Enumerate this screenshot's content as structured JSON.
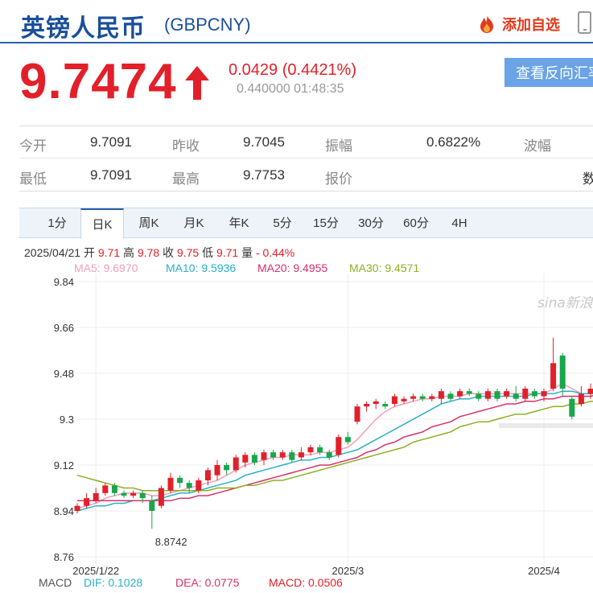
{
  "header": {
    "title": "英镑人民币",
    "code": "(GBPCNY)",
    "favorite_label": "添加自选"
  },
  "quote": {
    "price": "9.7474",
    "change": "0.0429 (0.4421%)",
    "sub": "0.440000 01:48:35",
    "reverse_label": "查看反向汇率"
  },
  "stats": [
    [
      {
        "label": "今开",
        "value": "9.7091"
      },
      {
        "label": "昨收",
        "value": "9.7045"
      },
      {
        "label": "振幅",
        "value": "0.6822%"
      },
      {
        "label": "波幅",
        "value": ""
      }
    ],
    [
      {
        "label": "最低",
        "value": "9.7091"
      },
      {
        "label": "最高",
        "value": "9.7753"
      },
      {
        "label": "报价",
        "value": "数"
      }
    ]
  ],
  "tabs": [
    "1分",
    "日K",
    "周K",
    "月K",
    "年K",
    "5分",
    "15分",
    "30分",
    "60分",
    "4H"
  ],
  "active_tab": "日K",
  "candle_info": {
    "date": "2025/04/21",
    "open_label": "开",
    "open": "9.71",
    "high_label": "高",
    "high": "9.78",
    "close_label": "收",
    "close": "9.75",
    "low_label": "低",
    "low": "9.71",
    "vol_label": "量",
    "vol": "-",
    "pct": "0.44%"
  },
  "ma_legend": [
    {
      "label": "MA5: 9.6970",
      "color": "#f0a0b8"
    },
    {
      "label": "MA10: 9.5936",
      "color": "#2ab0c8"
    },
    {
      "label": "MA20: 9.4955",
      "color": "#d8306a"
    },
    {
      "label": "MA30: 9.4571",
      "color": "#8cb020"
    }
  ],
  "macd": {
    "label": "MACD",
    "dif": "DIF: 0.1028",
    "dea": "DEA: 0.0775",
    "macd": "MACD: 0.0506"
  },
  "colors": {
    "up": "#e2202a",
    "down": "#1aa64a",
    "accent": "#1a4f9c"
  },
  "watermark": "sina新浪",
  "chart_data": {
    "type": "candlestick",
    "y_ticks": [
      "9.84",
      "9.66",
      "9.48",
      "9.3",
      "9.12",
      "8.94",
      "8.76"
    ],
    "ylim": [
      8.76,
      9.84
    ],
    "x_ticks": [
      {
        "label": "2025/1/22",
        "index": 2
      },
      {
        "label": "2025/3",
        "index": 29
      },
      {
        "label": "2025/4",
        "index": 50
      }
    ],
    "min_label": {
      "text": "8.8742",
      "index": 8,
      "value": 8.8742
    },
    "candles": [
      {
        "o": 8.94,
        "c": 8.96,
        "h": 8.97,
        "l": 8.93
      },
      {
        "o": 8.96,
        "c": 8.99,
        "h": 9.01,
        "l": 8.95
      },
      {
        "o": 8.98,
        "c": 9.01,
        "h": 9.03,
        "l": 8.97
      },
      {
        "o": 9.01,
        "c": 9.04,
        "h": 9.05,
        "l": 9.0
      },
      {
        "o": 9.04,
        "c": 9.01,
        "h": 9.05,
        "l": 9.0
      },
      {
        "o": 9.01,
        "c": 9.0,
        "h": 9.02,
        "l": 8.99
      },
      {
        "o": 9.0,
        "c": 9.01,
        "h": 9.02,
        "l": 8.99
      },
      {
        "o": 9.01,
        "c": 8.99,
        "h": 9.02,
        "l": 8.97
      },
      {
        "o": 8.98,
        "c": 8.94,
        "h": 9.0,
        "l": 8.87
      },
      {
        "o": 8.96,
        "c": 9.03,
        "h": 9.04,
        "l": 8.95
      },
      {
        "o": 9.02,
        "c": 9.07,
        "h": 9.09,
        "l": 9.01
      },
      {
        "o": 9.07,
        "c": 9.05,
        "h": 9.08,
        "l": 9.03
      },
      {
        "o": 9.05,
        "c": 9.03,
        "h": 9.06,
        "l": 9.01
      },
      {
        "o": 9.02,
        "c": 9.06,
        "h": 9.07,
        "l": 9.01
      },
      {
        "o": 9.06,
        "c": 9.1,
        "h": 9.11,
        "l": 9.04
      },
      {
        "o": 9.08,
        "c": 9.12,
        "h": 9.14,
        "l": 9.06
      },
      {
        "o": 9.12,
        "c": 9.1,
        "h": 9.13,
        "l": 9.08
      },
      {
        "o": 9.1,
        "c": 9.15,
        "h": 9.16,
        "l": 9.09
      },
      {
        "o": 9.13,
        "c": 9.16,
        "h": 9.17,
        "l": 9.11
      },
      {
        "o": 9.16,
        "c": 9.13,
        "h": 9.17,
        "l": 9.12
      },
      {
        "o": 9.14,
        "c": 9.17,
        "h": 9.18,
        "l": 9.12
      },
      {
        "o": 9.17,
        "c": 9.15,
        "h": 9.18,
        "l": 9.14
      },
      {
        "o": 9.15,
        "c": 9.17,
        "h": 9.18,
        "l": 9.14
      },
      {
        "o": 9.17,
        "c": 9.14,
        "h": 9.18,
        "l": 9.13
      },
      {
        "o": 9.15,
        "c": 9.17,
        "h": 9.19,
        "l": 9.14
      },
      {
        "o": 9.17,
        "c": 9.19,
        "h": 9.2,
        "l": 9.16
      },
      {
        "o": 9.19,
        "c": 9.17,
        "h": 9.2,
        "l": 9.16
      },
      {
        "o": 9.17,
        "c": 9.15,
        "h": 9.18,
        "l": 9.14
      },
      {
        "o": 9.16,
        "c": 9.23,
        "h": 9.24,
        "l": 9.15
      },
      {
        "o": 9.23,
        "c": 9.21,
        "h": 9.25,
        "l": 9.2
      },
      {
        "o": 9.29,
        "c": 9.35,
        "h": 9.36,
        "l": 9.28
      },
      {
        "o": 9.35,
        "c": 9.36,
        "h": 9.37,
        "l": 9.33
      },
      {
        "o": 9.36,
        "c": 9.37,
        "h": 9.38,
        "l": 9.34
      },
      {
        "o": 9.36,
        "c": 9.35,
        "h": 9.37,
        "l": 9.34
      },
      {
        "o": 9.36,
        "c": 9.39,
        "h": 9.4,
        "l": 9.35
      },
      {
        "o": 9.37,
        "c": 9.38,
        "h": 9.39,
        "l": 9.36
      },
      {
        "o": 9.38,
        "c": 9.39,
        "h": 9.4,
        "l": 9.37
      },
      {
        "o": 9.39,
        "c": 9.38,
        "h": 9.4,
        "l": 9.37
      },
      {
        "o": 9.38,
        "c": 9.39,
        "h": 9.4,
        "l": 9.37
      },
      {
        "o": 9.38,
        "c": 9.41,
        "h": 9.42,
        "l": 9.36
      },
      {
        "o": 9.4,
        "c": 9.38,
        "h": 9.41,
        "l": 9.37
      },
      {
        "o": 9.39,
        "c": 9.41,
        "h": 9.42,
        "l": 9.38
      },
      {
        "o": 9.41,
        "c": 9.4,
        "h": 9.42,
        "l": 9.39
      },
      {
        "o": 9.4,
        "c": 9.38,
        "h": 9.41,
        "l": 9.37
      },
      {
        "o": 9.38,
        "c": 9.41,
        "h": 9.42,
        "l": 9.37
      },
      {
        "o": 9.41,
        "c": 9.38,
        "h": 9.42,
        "l": 9.37
      },
      {
        "o": 9.39,
        "c": 9.41,
        "h": 9.42,
        "l": 9.38
      },
      {
        "o": 9.4,
        "c": 9.38,
        "h": 9.43,
        "l": 9.37
      },
      {
        "o": 9.38,
        "c": 9.42,
        "h": 9.43,
        "l": 9.37
      },
      {
        "o": 9.41,
        "c": 9.39,
        "h": 9.42,
        "l": 9.38
      },
      {
        "o": 9.39,
        "c": 9.41,
        "h": 9.42,
        "l": 9.37
      },
      {
        "o": 9.42,
        "c": 9.52,
        "h": 9.62,
        "l": 9.41
      },
      {
        "o": 9.55,
        "c": 9.42,
        "h": 9.56,
        "l": 9.39
      },
      {
        "o": 9.38,
        "c": 9.31,
        "h": 9.39,
        "l": 9.3
      },
      {
        "o": 9.36,
        "c": 9.4,
        "h": 9.43,
        "l": 9.35
      },
      {
        "o": 9.4,
        "c": 9.42,
        "h": 9.44,
        "l": 9.38
      },
      {
        "o": 9.41,
        "c": 9.45,
        "h": 9.47,
        "l": 9.39
      }
    ],
    "series": [
      {
        "name": "MA5",
        "color": "#f0a0b8",
        "values": [
          8.95,
          8.96,
          8.97,
          8.99,
          9.0,
          9.01,
          9.01,
          9.01,
          9.0,
          9.0,
          9.01,
          9.02,
          9.03,
          9.04,
          9.05,
          9.06,
          9.08,
          9.1,
          9.12,
          9.13,
          9.14,
          9.15,
          9.15,
          9.16,
          9.16,
          9.16,
          9.17,
          9.17,
          9.18,
          9.19,
          9.22,
          9.26,
          9.3,
          9.33,
          9.35,
          9.36,
          9.37,
          9.38,
          9.38,
          9.39,
          9.39,
          9.39,
          9.4,
          9.4,
          9.4,
          9.4,
          9.4,
          9.4,
          9.4,
          9.4,
          9.4,
          9.42,
          9.44,
          9.42,
          9.4,
          9.4,
          9.41
        ]
      },
      {
        "name": "MA10",
        "color": "#2ab0c8",
        "values": [
          8.94,
          8.95,
          8.96,
          8.96,
          8.97,
          8.97,
          8.98,
          8.98,
          8.98,
          8.99,
          9.0,
          9.01,
          9.01,
          9.02,
          9.03,
          9.04,
          9.05,
          9.06,
          9.08,
          9.09,
          9.1,
          9.11,
          9.12,
          9.13,
          9.14,
          9.14,
          9.15,
          9.15,
          9.16,
          9.17,
          9.18,
          9.2,
          9.22,
          9.24,
          9.26,
          9.28,
          9.3,
          9.32,
          9.34,
          9.36,
          9.37,
          9.38,
          9.38,
          9.39,
          9.39,
          9.39,
          9.39,
          9.39,
          9.39,
          9.4,
          9.4,
          9.4,
          9.41,
          9.41,
          9.4,
          9.4,
          9.4
        ]
      },
      {
        "name": "MA20",
        "color": "#d8306a",
        "values": [
          8.98,
          8.98,
          8.98,
          8.98,
          8.98,
          8.98,
          8.98,
          8.98,
          8.98,
          8.98,
          8.98,
          8.99,
          8.99,
          9.0,
          9.0,
          9.01,
          9.02,
          9.03,
          9.04,
          9.05,
          9.06,
          9.07,
          9.08,
          9.09,
          9.1,
          9.11,
          9.12,
          9.12,
          9.13,
          9.14,
          9.15,
          9.17,
          9.18,
          9.2,
          9.21,
          9.23,
          9.24,
          9.25,
          9.27,
          9.28,
          9.29,
          9.31,
          9.32,
          9.33,
          9.34,
          9.35,
          9.36,
          9.36,
          9.37,
          9.37,
          9.38,
          9.38,
          9.39,
          9.39,
          9.39,
          9.39,
          9.4
        ]
      },
      {
        "name": "MA30",
        "color": "#8cb020",
        "values": [
          9.08,
          9.07,
          9.06,
          9.05,
          9.04,
          9.03,
          9.03,
          9.02,
          9.02,
          9.02,
          9.02,
          9.02,
          9.02,
          9.02,
          9.02,
          9.03,
          9.03,
          9.03,
          9.04,
          9.04,
          9.05,
          9.06,
          9.06,
          9.07,
          9.08,
          9.09,
          9.1,
          9.11,
          9.12,
          9.13,
          9.14,
          9.15,
          9.16,
          9.17,
          9.18,
          9.19,
          9.21,
          9.22,
          9.23,
          9.24,
          9.25,
          9.27,
          9.28,
          9.29,
          9.29,
          9.3,
          9.31,
          9.32,
          9.32,
          9.33,
          9.34,
          9.35,
          9.35,
          9.36,
          9.36,
          9.37,
          9.37
        ]
      }
    ]
  }
}
